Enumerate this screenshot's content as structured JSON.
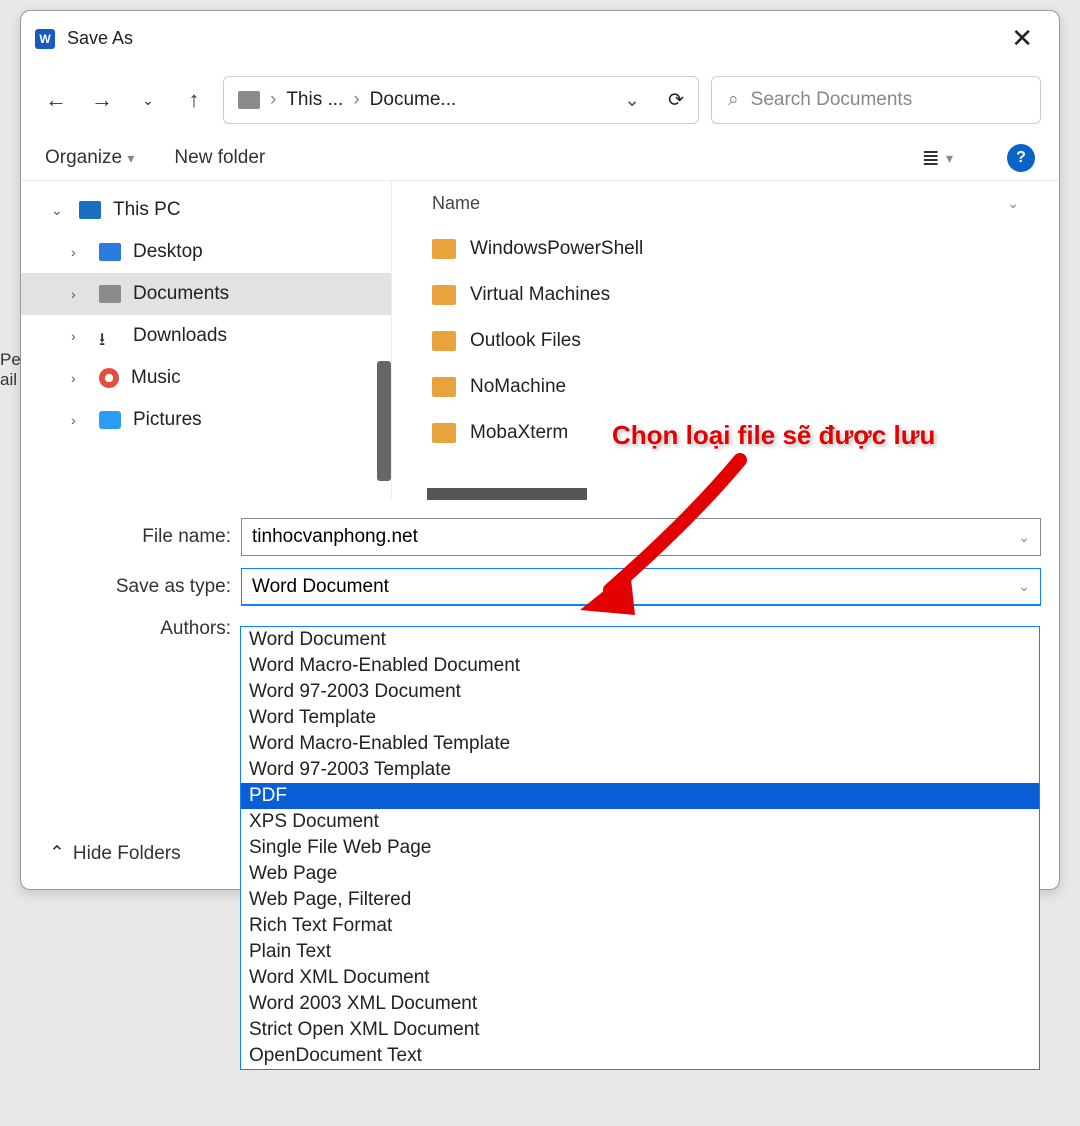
{
  "title": "Save As",
  "breadcrumbs": {
    "icon": "pc",
    "seg1": "This ...",
    "seg2": "Docume..."
  },
  "search": {
    "placeholder": "Search Documents"
  },
  "toolbar": {
    "organize": "Organize",
    "newfolder": "New folder"
  },
  "tree": {
    "root": "This PC",
    "items": [
      {
        "label": "Desktop",
        "icon": "pc2"
      },
      {
        "label": "Documents",
        "icon": "doc",
        "selected": true
      },
      {
        "label": "Downloads",
        "icon": "dl"
      },
      {
        "label": "Music",
        "icon": "music"
      },
      {
        "label": "Pictures",
        "icon": "pic"
      }
    ]
  },
  "list": {
    "header": "Name",
    "items": [
      "WindowsPowerShell",
      "Virtual Machines",
      "Outlook Files",
      "NoMachine",
      "MobaXterm"
    ]
  },
  "form": {
    "filename_label": "File name:",
    "filename_value": "tinhocvanphong.net",
    "saveastype_label": "Save as type:",
    "saveastype_value": "Word Document",
    "authors_label": "Authors:"
  },
  "type_options": [
    "Word Document",
    "Word Macro-Enabled Document",
    "Word 97-2003 Document",
    "Word Template",
    "Word Macro-Enabled Template",
    "Word 97-2003 Template",
    "PDF",
    "XPS Document",
    "Single File Web Page",
    "Web Page",
    "Web Page, Filtered",
    "Rich Text Format",
    "Plain Text",
    "Word XML Document",
    "Word 2003 XML Document",
    "Strict Open XML Document",
    "OpenDocument Text"
  ],
  "type_highlight_index": 6,
  "hide_folders": "Hide Folders",
  "annotation_text": "Chọn loại file sẽ được lưu",
  "sidehint": {
    "line1": "Pe",
    "line2": "ail"
  }
}
